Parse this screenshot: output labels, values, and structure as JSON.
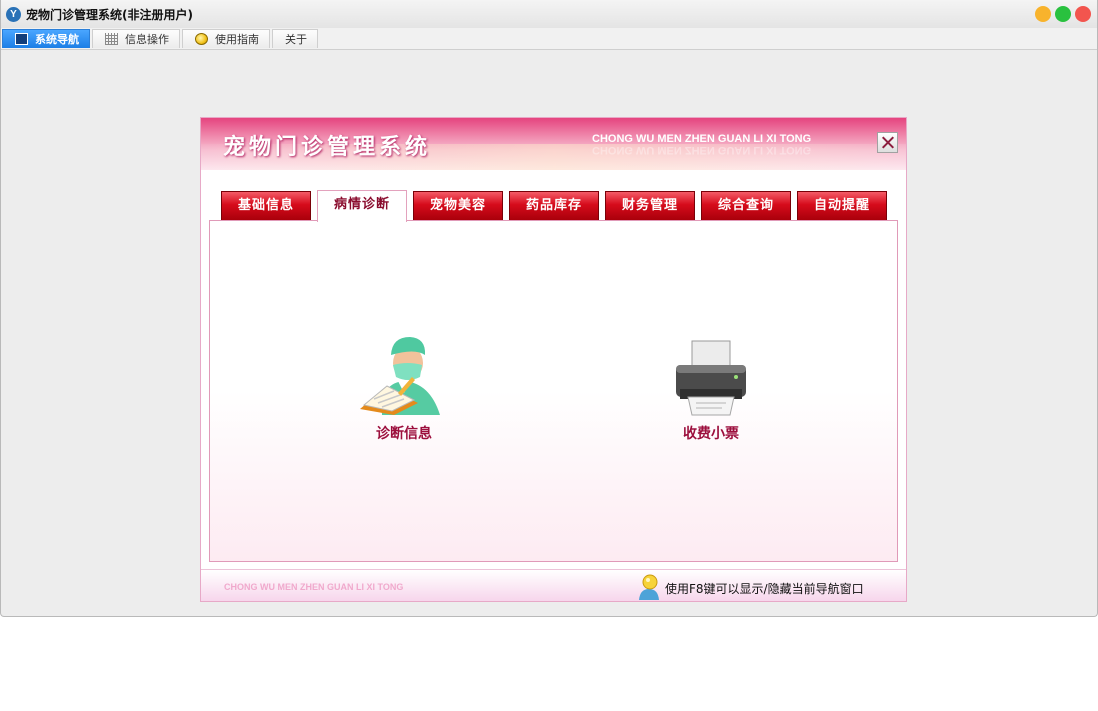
{
  "window": {
    "title": "宠物门诊管理系统(非注册用户)",
    "app_icon_glyph": "Y",
    "buttons": [
      "minimize",
      "maximize",
      "close"
    ]
  },
  "top_tabs": [
    {
      "label": "系统导航",
      "icon": "monitor-icon",
      "active": true
    },
    {
      "label": "信息操作",
      "icon": "grid-icon",
      "active": false
    },
    {
      "label": "使用指南",
      "icon": "lightbulb-icon",
      "active": false
    },
    {
      "label": "关于",
      "icon": "",
      "active": false
    }
  ],
  "panel": {
    "title": "宠物门诊管理系统",
    "pinyin": "CHONG WU MEN ZHEN GUAN LI XI TONG",
    "close_icon": "close-icon",
    "tabs": [
      {
        "label": "基础信息",
        "active": false
      },
      {
        "label": "病情诊断",
        "active": true
      },
      {
        "label": "宠物美容",
        "active": false
      },
      {
        "label": "药品库存",
        "active": false
      },
      {
        "label": "财务管理",
        "active": false
      },
      {
        "label": "综合查询",
        "active": false
      },
      {
        "label": "自动提醒",
        "active": false
      }
    ],
    "tools": [
      {
        "label": "诊断信息",
        "icon": "doctor-icon"
      },
      {
        "label": "收费小票",
        "icon": "printer-icon"
      }
    ],
    "footer": {
      "pinyin": "CHONG WU MEN ZHEN  GUAN LI XI TONG",
      "hint": "使用F8键可以显示/隐藏当前导航窗口",
      "hint_icon": "user-hint-icon"
    }
  },
  "colors": {
    "accent_blue": "#1c7ee6",
    "header_pink": "#e5447f",
    "tab_red": "#d60b1b",
    "label_crimson": "#9c0f3d"
  }
}
